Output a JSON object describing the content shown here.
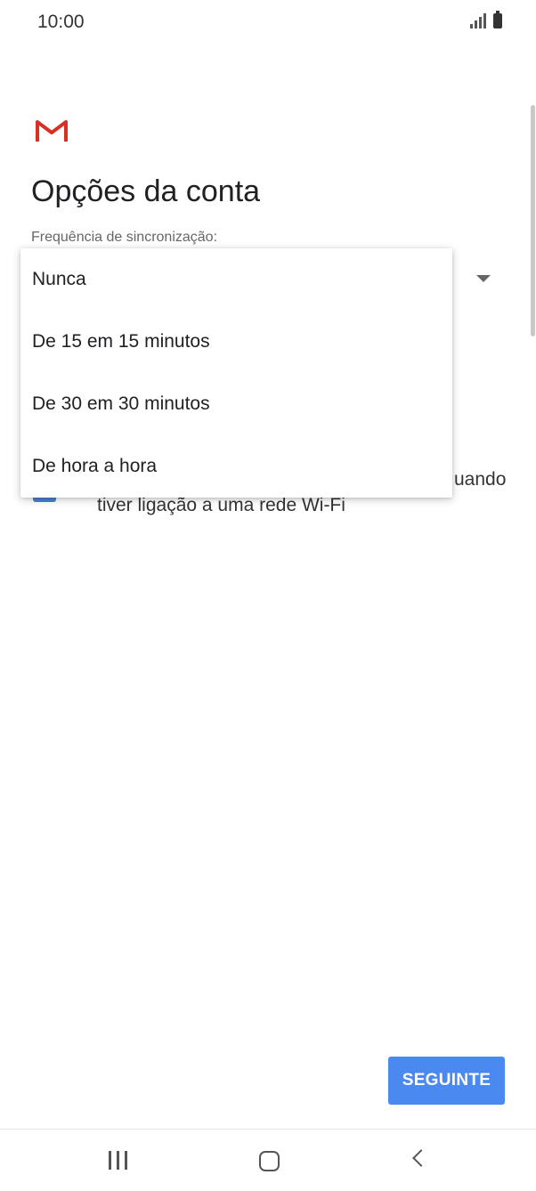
{
  "status_bar": {
    "time": "10:00"
  },
  "page": {
    "title": "Opções da conta",
    "sync_label": "Frequência de sincronização:"
  },
  "wifi_option": {
    "line1_visible": "uando",
    "line2": "tiver ligação a uma rede Wi-Fi",
    "checked": true
  },
  "dropdown": {
    "options": [
      "Nunca",
      "De 15 em 15 minutos",
      "De 30 em 30 minutos",
      "De hora a hora"
    ]
  },
  "footer": {
    "next_label": "SEGUINTE"
  },
  "colors": {
    "accent": "#4a89f0",
    "checkbox": "#4a7fd4",
    "gmail_red": "#d93025"
  },
  "icons": [
    "gmail-logo",
    "signal-icon",
    "battery-icon",
    "dropdown-arrow-icon",
    "recents-icon",
    "home-icon",
    "back-icon"
  ]
}
